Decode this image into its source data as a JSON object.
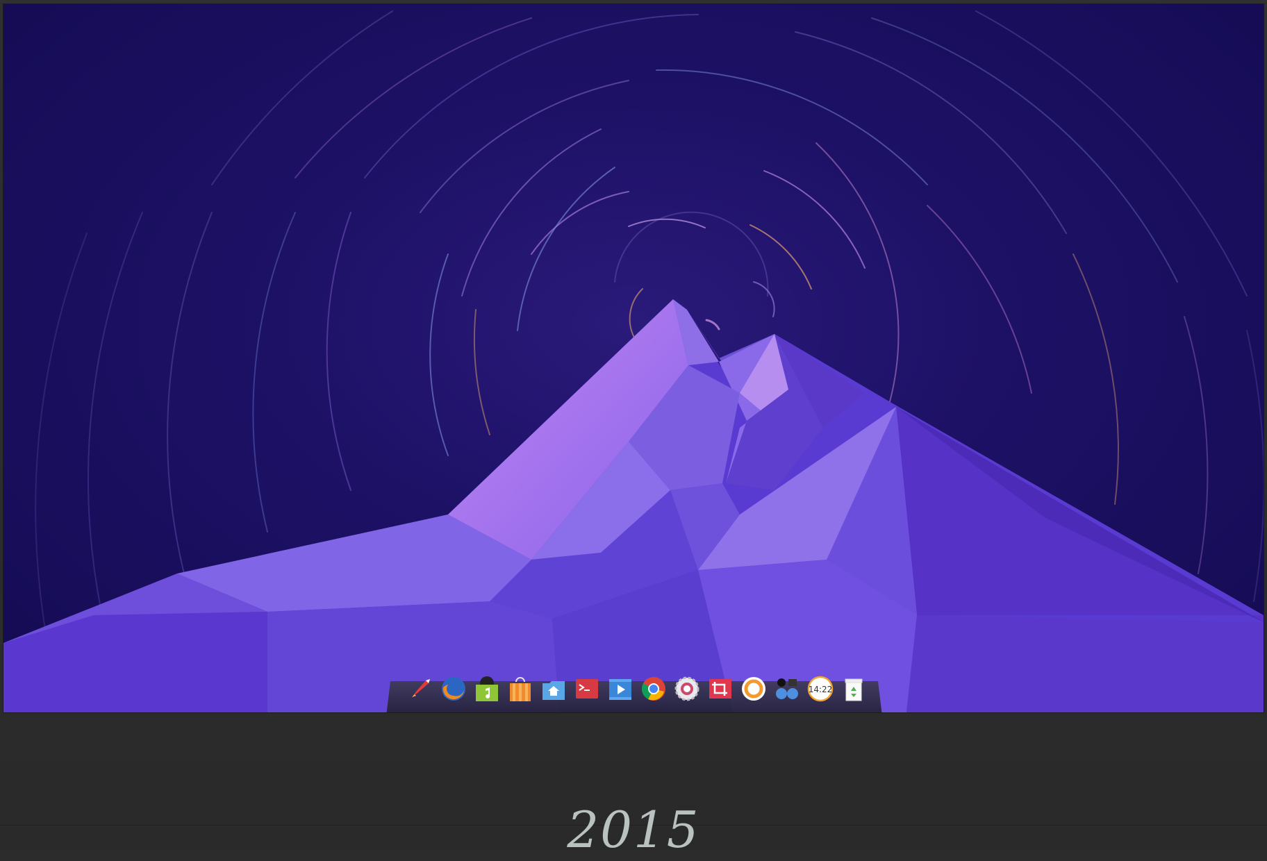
{
  "footer": {
    "year_label": "2015"
  },
  "colors": {
    "sky_dark": "#140b52",
    "sky_mid": "#1d1166",
    "mountain_light": "#b27df0",
    "mountain_mid": "#7b5ce8",
    "mountain_dark": "#4e2fc6",
    "frame": "#2c2c2c"
  },
  "dock": {
    "items": [
      {
        "icon": "rocket-launcher-icon"
      },
      {
        "icon": "firefox-icon"
      },
      {
        "icon": "music-player-icon"
      },
      {
        "icon": "store-icon"
      },
      {
        "icon": "file-manager-icon"
      },
      {
        "icon": "terminal-icon"
      },
      {
        "icon": "video-player-icon"
      },
      {
        "icon": "chrome-icon"
      },
      {
        "icon": "settings-icon"
      },
      {
        "icon": "screenshot-crop-icon"
      },
      {
        "icon": "browser-circle-icon"
      },
      {
        "icon": "control-center-icon"
      },
      {
        "icon": "clock-icon",
        "text": "14:22"
      },
      {
        "icon": "trash-icon"
      }
    ]
  }
}
